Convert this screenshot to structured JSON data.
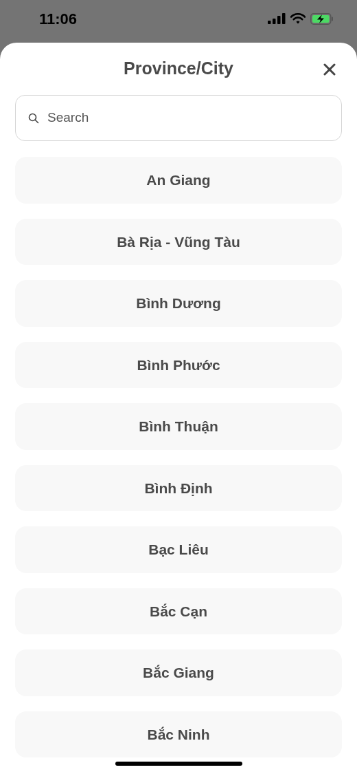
{
  "status_bar": {
    "time": "11:06"
  },
  "sheet": {
    "title": "Province/City"
  },
  "search": {
    "placeholder": "Search"
  },
  "items": [
    {
      "label": "An Giang"
    },
    {
      "label": "Bà Rịa - Vũng Tàu"
    },
    {
      "label": "Bình Dương"
    },
    {
      "label": "Bình Phước"
    },
    {
      "label": "Bình Thuận"
    },
    {
      "label": "Bình Định"
    },
    {
      "label": "Bạc Liêu"
    },
    {
      "label": "Bắc Cạn"
    },
    {
      "label": "Bắc Giang"
    },
    {
      "label": "Bắc Ninh"
    }
  ]
}
